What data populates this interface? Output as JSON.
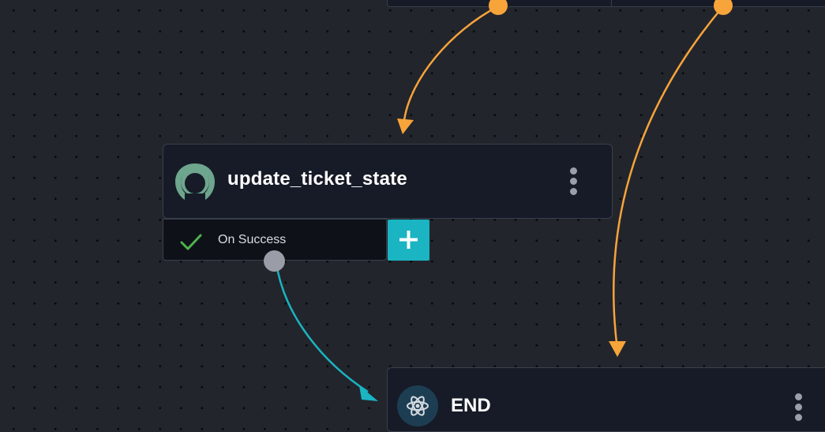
{
  "workflow": {
    "nodes": {
      "update_ticket_state": {
        "title": "update_ticket_state",
        "icon": "app-logo-icon",
        "outcome_label": "On Success",
        "outcome_icon": "checkmark-icon",
        "add_button_icon": "plus-icon"
      },
      "end": {
        "title": "END",
        "icon": "atom-icon"
      }
    },
    "colors": {
      "canvas_bg": "#23252c",
      "node_bg": "#161b27",
      "edge_orange": "#f7a43b",
      "edge_teal": "#1ab4c2",
      "success_green": "#4db34d",
      "add_button": "#1ab4c2"
    }
  }
}
